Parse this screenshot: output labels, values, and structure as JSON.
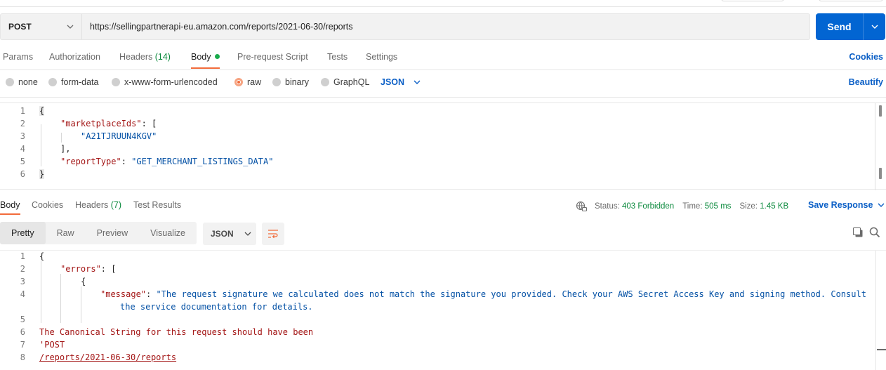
{
  "request": {
    "method": "POST",
    "url": "https://sellingpartnerapi-eu.amazon.com/reports/2021-06-30/reports",
    "send_label": "Send"
  },
  "request_tabs": {
    "params": "Params",
    "authorization": "Authorization",
    "headers": "Headers",
    "headers_count": "(14)",
    "body": "Body",
    "pre_request": "Pre-request Script",
    "tests": "Tests",
    "settings": "Settings",
    "cookies": "Cookies"
  },
  "body_types": {
    "none": "none",
    "form_data": "form-data",
    "urlencoded": "x-www-form-urlencoded",
    "raw": "raw",
    "binary": "binary",
    "graphql": "GraphQL",
    "language": "JSON",
    "beautify": "Beautify"
  },
  "request_body": {
    "line_numbers": [
      "1",
      "2",
      "3",
      "4",
      "5",
      "6"
    ],
    "open_brace": "{",
    "key_marketplace": "\"marketplaceIds\"",
    "colon_bracket": ": [",
    "marketplace_id": "\"A21TJRUUN4KGV\"",
    "close_bracket": "],",
    "key_report_type": "\"reportType\"",
    "colon": ": ",
    "report_type": "\"GET_MERCHANT_LISTINGS_DATA\"",
    "close_brace": "}"
  },
  "response_tabs": {
    "body": "Body",
    "cookies": "Cookies",
    "headers": "Headers",
    "headers_count": "(7)",
    "test_results": "Test Results"
  },
  "response_status": {
    "status_label": "Status:",
    "status_value": "403 Forbidden",
    "time_label": "Time:",
    "time_value": "505 ms",
    "size_label": "Size:",
    "size_value": "1.45 KB",
    "save_response": "Save Response"
  },
  "response_view": {
    "pretty": "Pretty",
    "raw": "Raw",
    "preview": "Preview",
    "visualize": "Visualize",
    "format": "JSON"
  },
  "response_body": {
    "line_numbers": [
      "1",
      "2",
      "3",
      "4",
      "5",
      "6",
      "7",
      "8"
    ],
    "open_brace": "{",
    "key_errors": "\"errors\"",
    "colon_bracket": ": [",
    "inner_brace": "{",
    "key_message": "\"message\"",
    "colon": ": ",
    "message_part1": "\"The request signature we calculated does not match the signature you provided. Check your AWS Secret Access Key and signing method. Consult",
    "message_part2": "the service documentation for details.",
    "line6": "The Canonical String for this request should have been",
    "line7": "'POST",
    "line8": "/reports/2021-06-30/reports"
  }
}
